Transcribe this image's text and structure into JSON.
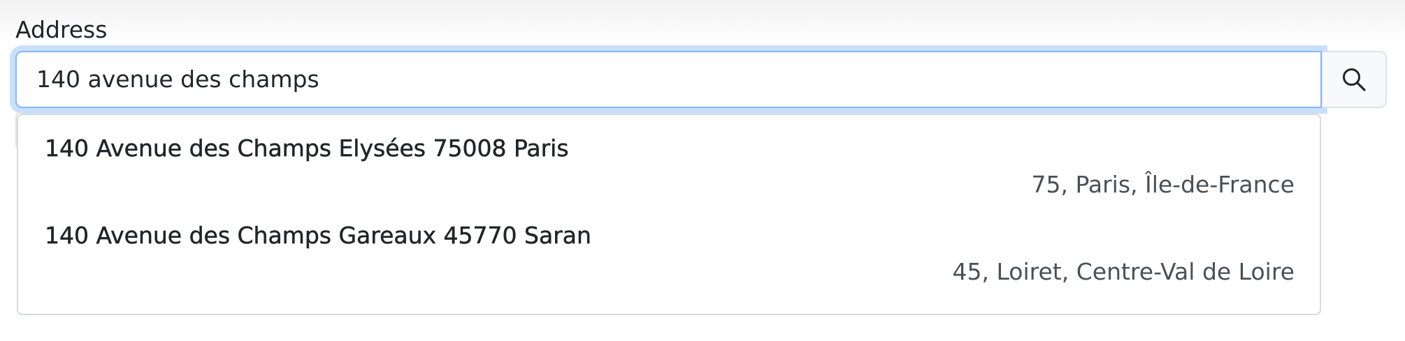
{
  "address": {
    "label": "Address",
    "value": "140 avenue des champs"
  },
  "search_button": {
    "icon": "search-icon"
  },
  "colors": {
    "focus_border": "#86b7fe",
    "focus_glow": "#cfe2ff",
    "border": "#dee2e6",
    "text": "#212529"
  },
  "suggestions": [
    {
      "main": "140 Avenue des Champs Elysées 75008 Paris",
      "sub": "75, Paris, Île-de-France"
    },
    {
      "main": "140 Avenue des Champs Gareaux 45770 Saran",
      "sub": "45, Loiret, Centre-Val de Loire"
    }
  ]
}
